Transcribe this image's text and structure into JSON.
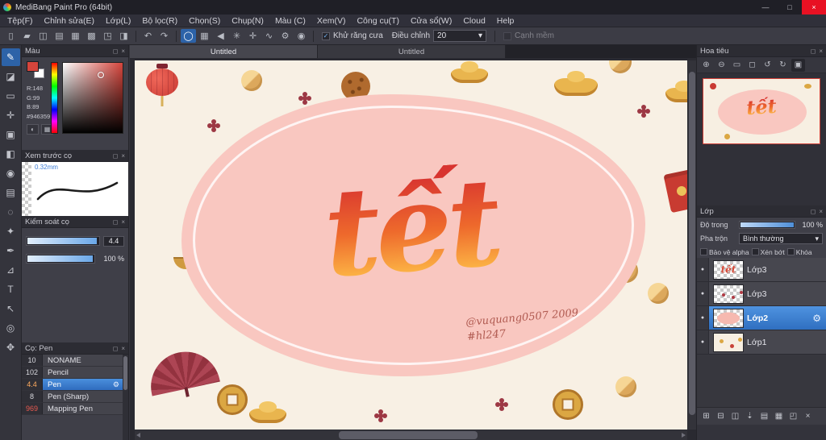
{
  "window": {
    "title": "MediBang Paint Pro (64bit)"
  },
  "icons": {
    "win_min": "—",
    "win_max": "□",
    "win_close": "×",
    "popout": "◻",
    "close": "×",
    "check": "✓",
    "gear": "⚙",
    "eye": "●",
    "dropdown_arrow": "▾"
  },
  "menu": {
    "items": [
      "Tệp(F)",
      "Chỉnh sửa(E)",
      "Lớp(L)",
      "Bộ lọc(R)",
      "Chọn(S)",
      "Chụp(N)",
      "Màu (C)",
      "Xem(V)",
      "Công cụ(T)",
      "Cửa sổ(W)",
      "Cloud",
      "Help"
    ]
  },
  "toolbar": {
    "file_icons": [
      "▯",
      "▰",
      "◫",
      "▤",
      "▦",
      "▩",
      "◳",
      "◨"
    ],
    "undo_icon": "↶",
    "redo_icon": "↷",
    "option_icons": [
      "◯",
      "▦",
      "◀",
      "✳",
      "✛",
      "∿",
      "⚙",
      "◉"
    ],
    "antialias_label": "Khử răng cưa",
    "adjust_label": "Điều chỉnh",
    "adjust_value": "20",
    "soft_edge_label": "Cạnh mềm"
  },
  "tools": {
    "glyphs": [
      "✎",
      "◪",
      "▭",
      "✛",
      "▣",
      "◧",
      "◉",
      "▤",
      "◌",
      "✦",
      "✒",
      "⊿",
      "T",
      "↖",
      "◎",
      "✥"
    ]
  },
  "color_panel": {
    "title": "Màu",
    "r": "R:148",
    "g": "G:99",
    "b": "B:89",
    "hex": "#946359",
    "button_icons": [
      "◐",
      "▦"
    ]
  },
  "brush_preview": {
    "title": "Xem trước cọ",
    "size": "0.32mm"
  },
  "brush_control": {
    "title": "Kiểm soát cọ",
    "size_value": "4.4",
    "opacity_value": "100 %"
  },
  "brush_list": {
    "title": "Cọ: Pen",
    "items": [
      {
        "size": "10",
        "name": "NONAME"
      },
      {
        "size": "102",
        "name": "Pencil"
      },
      {
        "size": "4.4",
        "name": "Pen"
      },
      {
        "size": "8",
        "name": "Pen (Sharp)"
      },
      {
        "size": "969",
        "name": "Mapping Pen"
      }
    ]
  },
  "tabs": [
    {
      "label": "Untitled"
    },
    {
      "label": "Untitled"
    }
  ],
  "canvas": {
    "title_text": "tết",
    "signature_line1": "@vuquang0507 2009",
    "signature_line2": "#hl247"
  },
  "navigator": {
    "title": "Hoa tiêu",
    "icons": [
      "⊕",
      "⊖",
      "▭",
      "◻",
      "↺",
      "↻",
      "▣"
    ]
  },
  "layer_panel": {
    "title": "Lớp",
    "opacity_label": "Độ trong",
    "opacity_value": "100 %",
    "blend_label": "Pha trộn",
    "blend_value": "Bình thường",
    "check_labels": [
      "Bảo vệ alpha",
      "Xén bớt",
      "Khóa"
    ],
    "layers": [
      {
        "name": "Lớp3"
      },
      {
        "name": "Lớp3"
      },
      {
        "name": "Lớp2"
      },
      {
        "name": "Lớp1"
      }
    ],
    "bottom_icons": [
      "⊞",
      "⊟",
      "◫",
      "⇣",
      "▤",
      "▦",
      "◰",
      "×"
    ]
  }
}
